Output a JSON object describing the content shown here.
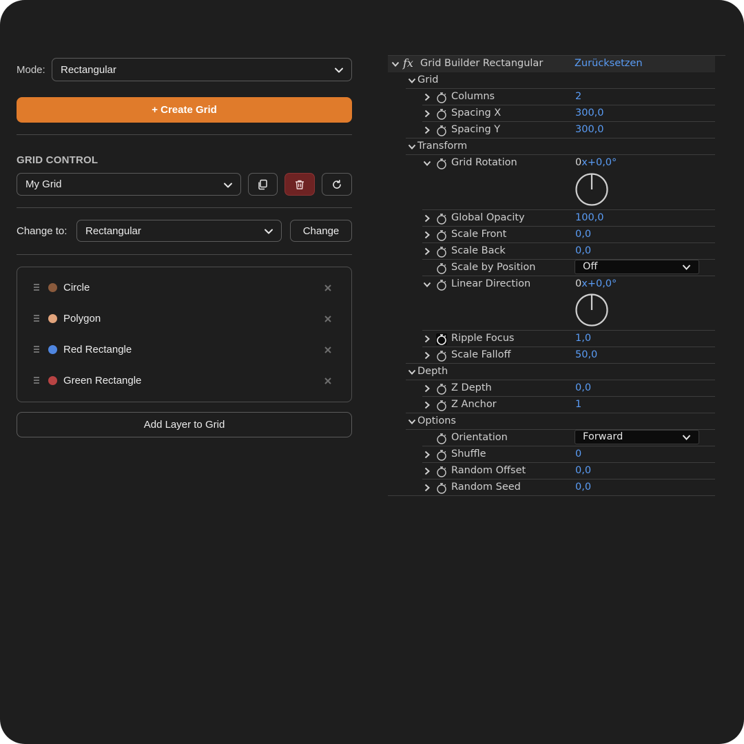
{
  "left": {
    "mode_label": "Mode:",
    "mode_value": "Rectangular",
    "create_button": "+ Create Grid",
    "grid_control_title": "GRID CONTROL",
    "grid_select_value": "My Grid",
    "change_label": "Change to:",
    "change_select_value": "Rectangular",
    "change_button": "Change",
    "layers": [
      {
        "name": "Circle",
        "color": "#8a5a3c"
      },
      {
        "name": "Polygon",
        "color": "#e2a47c"
      },
      {
        "name": "Red Rectangle",
        "color": "#4f86e0"
      },
      {
        "name": "Green Rectangle",
        "color": "#b84343"
      }
    ],
    "add_layer_button": "Add Layer to Grid"
  },
  "right": {
    "effect_name": "Grid Builder Rectangular",
    "reset_label": "Zurücksetzen",
    "groups": {
      "grid": "Grid",
      "transform": "Transform",
      "depth": "Depth",
      "options": "Options"
    },
    "props": {
      "columns": {
        "label": "Columns",
        "value": "2"
      },
      "spacing_x": {
        "label": "Spacing X",
        "value": "300,0"
      },
      "spacing_y": {
        "label": "Spacing Y",
        "value": "300,0"
      },
      "grid_rotation": {
        "label": "Grid Rotation",
        "turns": "0",
        "angle": "x+0,0°"
      },
      "global_opacity": {
        "label": "Global Opacity",
        "value": "100,0"
      },
      "scale_front": {
        "label": "Scale Front",
        "value": "0,0"
      },
      "scale_back": {
        "label": "Scale Back",
        "value": "0,0"
      },
      "scale_by_position": {
        "label": "Scale by Position",
        "value": "Off"
      },
      "linear_direction": {
        "label": "Linear Direction",
        "turns": "0",
        "angle": "x+0,0°"
      },
      "ripple_focus": {
        "label": "Ripple Focus",
        "value": "1,0"
      },
      "scale_falloff": {
        "label": "Scale Falloff",
        "value": "50,0"
      },
      "z_depth": {
        "label": "Z Depth",
        "value": "0,0"
      },
      "z_anchor": {
        "label": "Z Anchor",
        "value": "1"
      },
      "orientation": {
        "label": "Orientation",
        "value": "Forward"
      },
      "shuffle": {
        "label": "Shuffle",
        "value": "0"
      },
      "random_offset": {
        "label": "Random Offset",
        "value": "0,0"
      },
      "random_seed": {
        "label": "Random Seed",
        "value": "0,0"
      }
    }
  },
  "colors": {
    "accent_orange": "#e07b2b",
    "danger_red": "#6e2323",
    "value_blue": "#5a9cf5",
    "background": "#1e1e1e"
  }
}
